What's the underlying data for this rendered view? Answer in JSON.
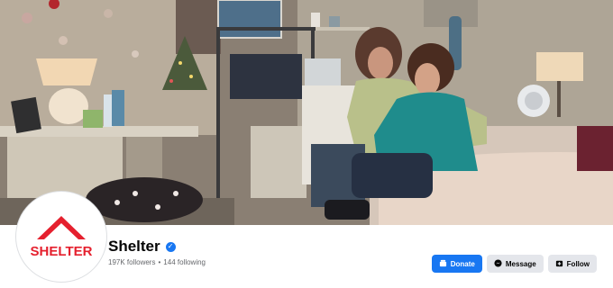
{
  "page": {
    "name": "Shelter",
    "verified_glyph": "✓",
    "followers": "197K followers",
    "separator": "•",
    "following": "144 following"
  },
  "avatar": {
    "logo_text": "SHELTER",
    "brand_color": "#e5202e"
  },
  "actions": {
    "donate_label": "Donate",
    "message_label": "Message",
    "follow_label": "Follow"
  },
  "icons": {
    "donate": "donate-icon",
    "message": "messenger-icon",
    "follow": "follow-icon",
    "verified": "verified-badge-icon"
  },
  "colors": {
    "accent": "#1877f2",
    "secondary_button": "#e4e6eb",
    "text_primary": "#050505",
    "text_secondary": "#65676b"
  }
}
